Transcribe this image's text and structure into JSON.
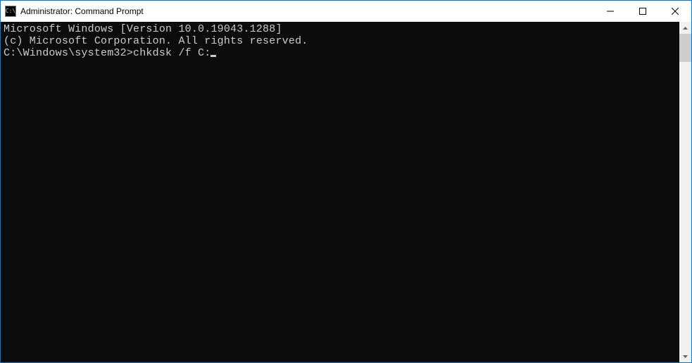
{
  "window": {
    "title": "Administrator: Command Prompt",
    "icon_text": "C:\\"
  },
  "terminal": {
    "line1": "Microsoft Windows [Version 10.0.19043.1288]",
    "line2": "(c) Microsoft Corporation. All rights reserved.",
    "blank": "",
    "prompt": "C:\\Windows\\system32>",
    "command": "chkdsk /f C:"
  }
}
